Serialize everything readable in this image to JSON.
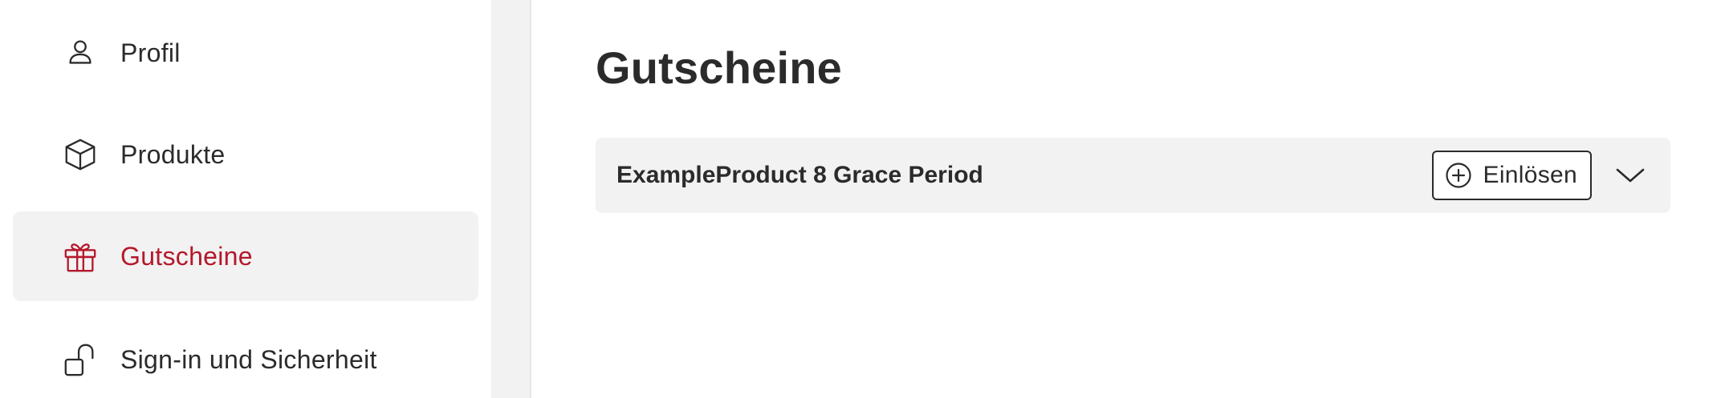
{
  "sidebar": {
    "items": [
      {
        "label": "Profil",
        "icon": "user-icon",
        "active": false
      },
      {
        "label": "Produkte",
        "icon": "box-icon",
        "active": false
      },
      {
        "label": "Gutscheine",
        "icon": "gift-icon",
        "active": true
      },
      {
        "label": "Sign-in und Sicherheit",
        "icon": "unlock-icon",
        "active": false
      }
    ]
  },
  "main": {
    "title": "Gutscheine",
    "vouchers": [
      {
        "name": "ExampleProduct 8 Grace Period",
        "redeem_label": "Einlösen",
        "redeem_icon": "plus-circle-icon",
        "expand_icon": "chevron-down-icon"
      }
    ]
  },
  "colors": {
    "accent": "#b5182b",
    "text": "#2b2b2b",
    "surface": "#f2f2f2"
  }
}
